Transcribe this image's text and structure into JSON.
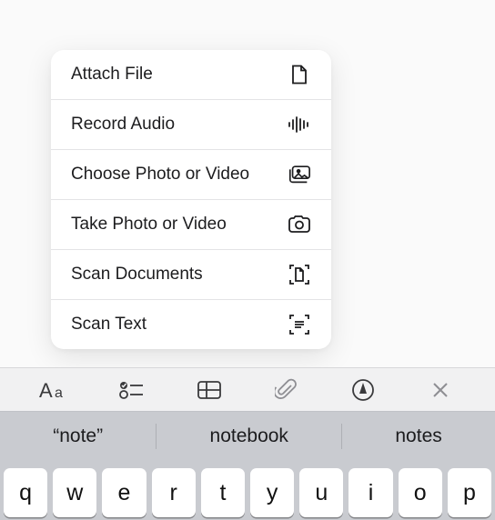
{
  "menu": {
    "items": [
      {
        "label": "Attach File",
        "icon": "file-icon"
      },
      {
        "label": "Record Audio",
        "icon": "waveform-icon"
      },
      {
        "label": "Choose Photo or Video",
        "icon": "gallery-icon"
      },
      {
        "label": "Take Photo or Video",
        "icon": "camera-icon"
      },
      {
        "label": "Scan Documents",
        "icon": "scan-doc-icon"
      },
      {
        "label": "Scan Text",
        "icon": "scan-text-icon"
      }
    ]
  },
  "toolbar": {
    "buttons": [
      {
        "name": "text-format-button",
        "icon": "aa-icon"
      },
      {
        "name": "checklist-button",
        "icon": "checklist-icon"
      },
      {
        "name": "table-button",
        "icon": "table-icon"
      },
      {
        "name": "attachment-button",
        "icon": "paperclip-icon"
      },
      {
        "name": "markup-button",
        "icon": "markup-icon"
      },
      {
        "name": "close-toolbar-button",
        "icon": "close-icon"
      }
    ]
  },
  "predictive": {
    "suggestions": [
      "“note”",
      "notebook",
      "notes"
    ]
  },
  "keyboard": {
    "row1": [
      "q",
      "w",
      "e",
      "r",
      "t",
      "y",
      "u",
      "i",
      "o",
      "p"
    ]
  }
}
